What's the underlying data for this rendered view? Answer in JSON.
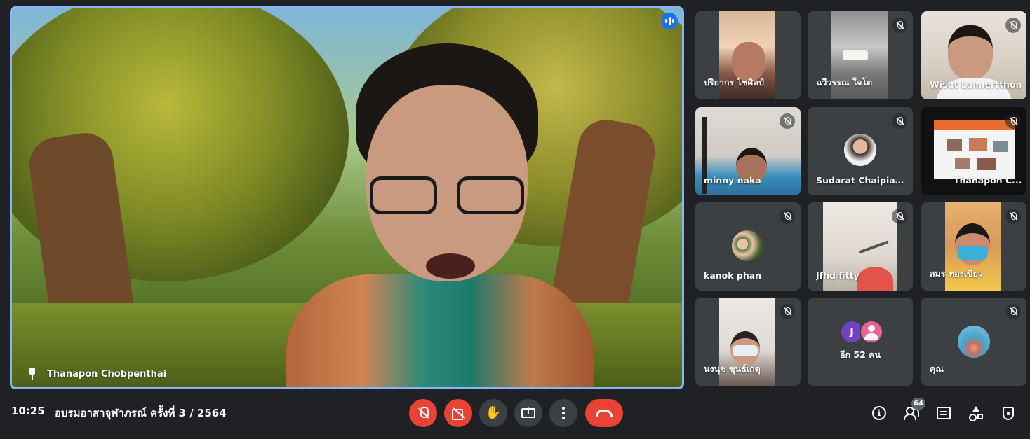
{
  "main": {
    "speaker_name": "Thanapon Chobpenthai"
  },
  "participants": [
    {
      "name": "ปริยากร ไชศิลป์",
      "muted": false
    },
    {
      "name": "ฉวีวรรณ ใจโต",
      "muted": true
    },
    {
      "name": "Wisut Lamlertthon",
      "muted": true
    },
    {
      "name": "minny naka",
      "muted": true
    },
    {
      "name": "Sudarat Chaipianc...",
      "muted": true
    },
    {
      "name": "Thanapon C...",
      "muted": true
    },
    {
      "name": "kanok phan",
      "muted": true
    },
    {
      "name": "Jfhd fitty",
      "muted": true
    },
    {
      "name": "สมร ทองเขียว",
      "muted": true
    },
    {
      "name": "นงนุช ขุนธ์เกตุ",
      "muted": true
    },
    {
      "name": "อีก 52 คน",
      "avatar_initial": "J"
    },
    {
      "name": "คุณ",
      "muted": true
    }
  ],
  "bottom_bar": {
    "time": "10:25",
    "meeting_title": "อบรมอาสาจุฬาภรณ์ ครั้งที่ 3 / 2564",
    "participant_count": "64"
  },
  "colors": {
    "background": "#202124",
    "tile": "#3c4043",
    "danger": "#ea4335",
    "active_border": "#8ab4f8"
  },
  "icons": [
    "pin-icon",
    "speaking-icon",
    "mic-off-icon",
    "camera-off-icon",
    "raise-hand-icon",
    "present-screen-icon",
    "more-options-icon",
    "end-call-icon",
    "info-icon",
    "people-icon",
    "chat-icon",
    "activities-icon",
    "host-controls-icon"
  ]
}
